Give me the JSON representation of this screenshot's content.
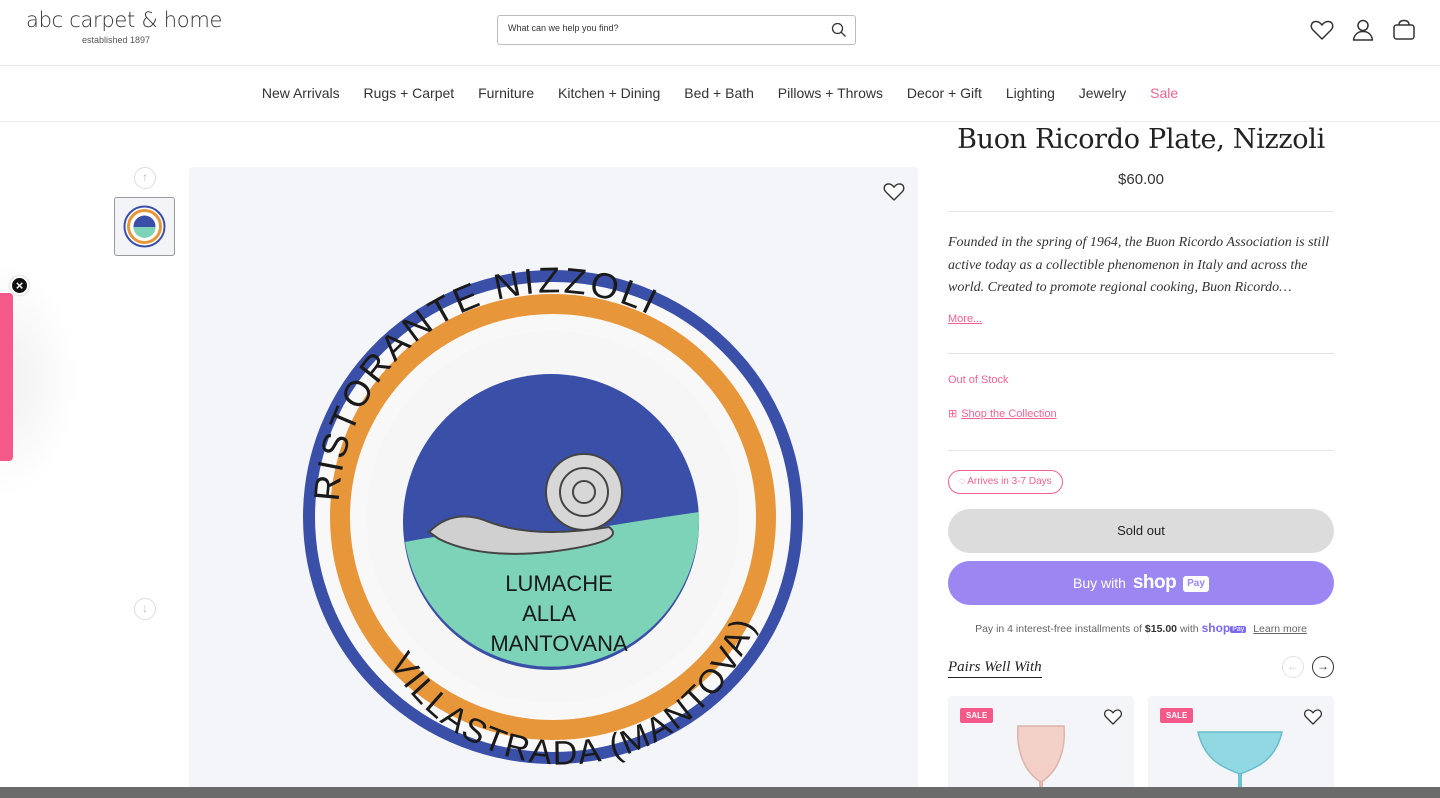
{
  "header": {
    "logo": "abc carpet & home",
    "logo_sub": "established 1897",
    "search_placeholder": "What can we help you find?"
  },
  "nav": {
    "items": [
      "New Arrivals",
      "Rugs + Carpet",
      "Furniture",
      "Kitchen + Dining",
      "Bed + Bath",
      "Pillows + Throws",
      "Decor + Gift",
      "Lighting",
      "Jewelry",
      "Sale"
    ]
  },
  "product": {
    "title": "Buon Ricordo Plate, Nizzoli",
    "price": "$60.00",
    "description": "Founded in the spring of 1964, the Buon Ricordo Association is still active today as a collectible phenomenon in Italy and across the world. Created to promote regional cooking, Buon Ricordo…",
    "more_label": "More...",
    "stock_status": "Out of Stock",
    "collection_label": "Shop the Collection",
    "arrives_label": "Arrives in 3-7 Days",
    "soldout_label": "Sold out",
    "buy_with": "Buy with",
    "shop_brand": "shop",
    "pay_badge": "Pay",
    "installments_prefix": "Pay in 4 interest-free installments of",
    "installment_amount": "$15.00",
    "installments_with": "with",
    "learn_more": "Learn more",
    "pairs_title": "Pairs Well With"
  },
  "plate_text": {
    "rim_top": "RISTORANTE NIZZOLI",
    "rim_bottom": "VILLASTRADA (MANTOVA)",
    "center_line1": "LUMACHE",
    "center_line2": "ALLA",
    "center_line3": "MANTOVANA"
  },
  "pairs_cards": [
    {
      "badge": "SALE"
    },
    {
      "badge": "SALE"
    }
  ],
  "colors": {
    "accent_pink": "#f06292",
    "shop_purple": "#9b86f2",
    "plate_blue": "#3a4fa8",
    "plate_orange": "#e8963a",
    "plate_green": "#7dd3b8"
  }
}
